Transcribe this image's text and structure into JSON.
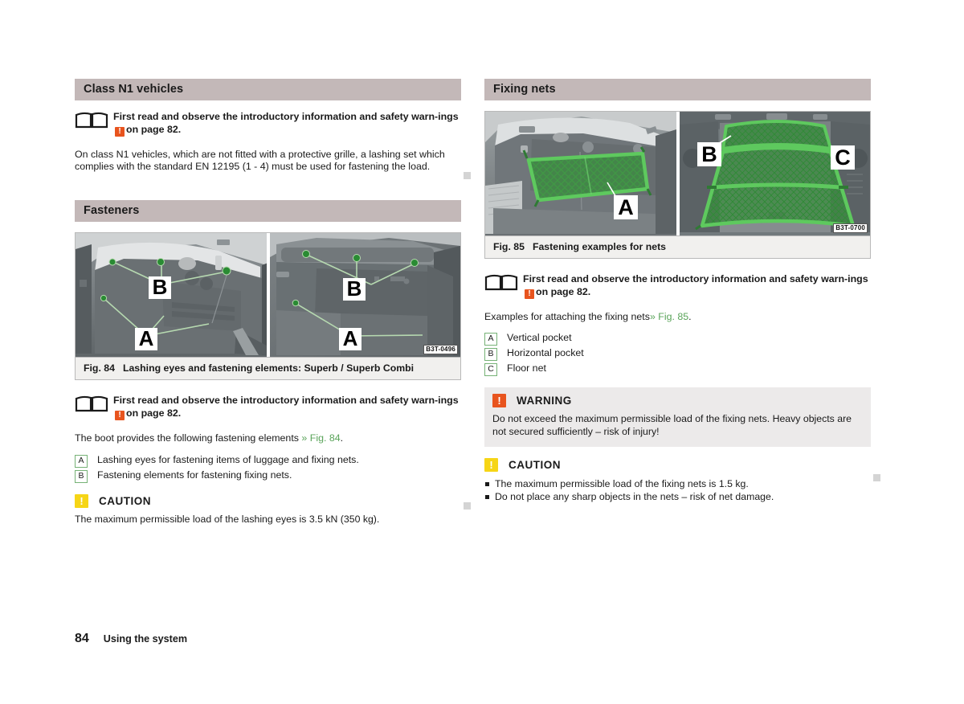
{
  "page": {
    "number": "84",
    "running_title": "Using the system"
  },
  "colors": {
    "section_header_bg": "#c3b8b8",
    "warning_orange": "#e8541e",
    "caution_yellow": "#f6d516",
    "link_green": "#5aa45a",
    "letter_box_border": "#76b276",
    "warning_block_bg": "#eceaea",
    "endmark_gray": "#d4d4d4"
  },
  "left_column": {
    "section_n1": {
      "header": "Class N1 vehicles",
      "note": {
        "icon": "open-book-icon",
        "text_before": "First read and observe the introductory information and safety warn-ings",
        "warn_glyph": "!",
        "text_after": "on page 82."
      },
      "paragraph": "On class N1 vehicles, which are not fitted with a protective grille, a lashing set which complies with the standard EN 12195 (1 - 4) must be used for fastening the load."
    },
    "section_fasteners": {
      "header": "Fasteners",
      "figure": {
        "caption_number": "Fig. 84",
        "caption_text": "Lashing eyes and fastening elements: Superb / Superb Combi",
        "part_number": "B3T-0496",
        "callouts": [
          "B",
          "A",
          "B",
          "A"
        ]
      },
      "note": {
        "icon": "open-book-icon",
        "text_before": "First read and observe the introductory information and safety warn-ings",
        "warn_glyph": "!",
        "text_after": "on page 82."
      },
      "intro": {
        "text": "The boot provides the following fastening elements",
        "link": "» Fig. 84",
        "suffix": "."
      },
      "items": [
        {
          "key": "A",
          "text": "Lashing eyes for fastening items of luggage and fixing nets."
        },
        {
          "key": "B",
          "text": "Fastening elements for fastening fixing nets."
        }
      ],
      "caution": {
        "glyph": "!",
        "title": "CAUTION",
        "body": "The maximum permissible load of the lashing eyes is 3.5 kN (350 kg)."
      }
    }
  },
  "right_column": {
    "section_nets": {
      "header": "Fixing nets",
      "figure": {
        "caption_number": "Fig. 85",
        "caption_text": "Fastening examples for nets",
        "part_number": "B3T-0700",
        "callouts": [
          "A",
          "B",
          "C"
        ]
      },
      "note": {
        "icon": "open-book-icon",
        "text_before": "First read and observe the introductory information and safety warn-ings",
        "warn_glyph": "!",
        "text_after": "on page 82."
      },
      "intro": {
        "text": "Examples for attaching the fixing nets",
        "link": "» Fig. 85",
        "suffix": "."
      },
      "items": [
        {
          "key": "A",
          "text": "Vertical pocket"
        },
        {
          "key": "B",
          "text": "Horizontal pocket"
        },
        {
          "key": "C",
          "text": "Floor net"
        }
      ],
      "warning": {
        "glyph": "!",
        "title": "WARNING",
        "body": "Do not exceed the maximum permissible load of the fixing nets. Heavy objects are not secured sufficiently – risk of injury!"
      },
      "caution": {
        "glyph": "!",
        "title": "CAUTION",
        "bullets": [
          "The maximum permissible load of the fixing nets is 1.5 kg.",
          "Do not place any sharp objects in the nets – risk of net damage."
        ]
      }
    }
  }
}
